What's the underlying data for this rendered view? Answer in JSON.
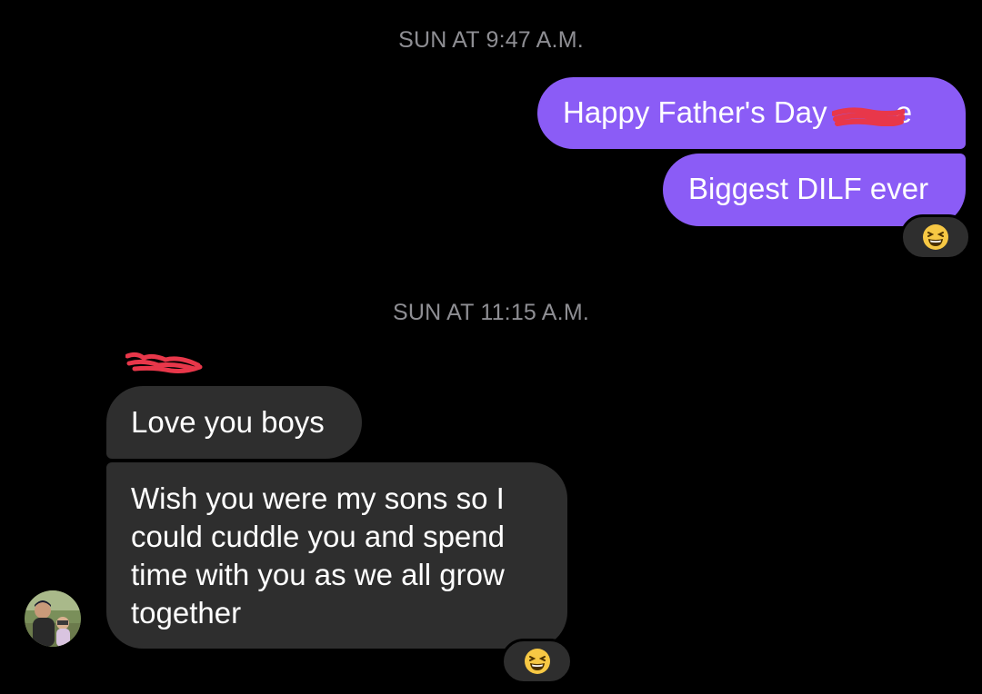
{
  "conversation": {
    "timestamps": [
      "SUN AT 9:47 A.M.",
      "SUN AT 11:15 A.M."
    ],
    "sent_messages": [
      {
        "text_before_redaction": "Happy Father's Day ",
        "text_after_redaction": "e",
        "reaction": "laughing-emoji"
      },
      {
        "text": "Biggest DILF ever",
        "reaction": "laughing-emoji"
      }
    ],
    "received_messages": [
      {
        "text": "Love you boys"
      },
      {
        "text": "Wish you were my sons so I could cuddle you and spend time with you as we all grow together",
        "reaction": "laughing-emoji"
      }
    ],
    "sender_name_redacted": true
  },
  "colors": {
    "background": "#000000",
    "sent_bubble": "#8b5cf6",
    "received_bubble": "#2e2e2e",
    "timestamp_text": "#8e8e93",
    "redaction": "#e8374a"
  }
}
